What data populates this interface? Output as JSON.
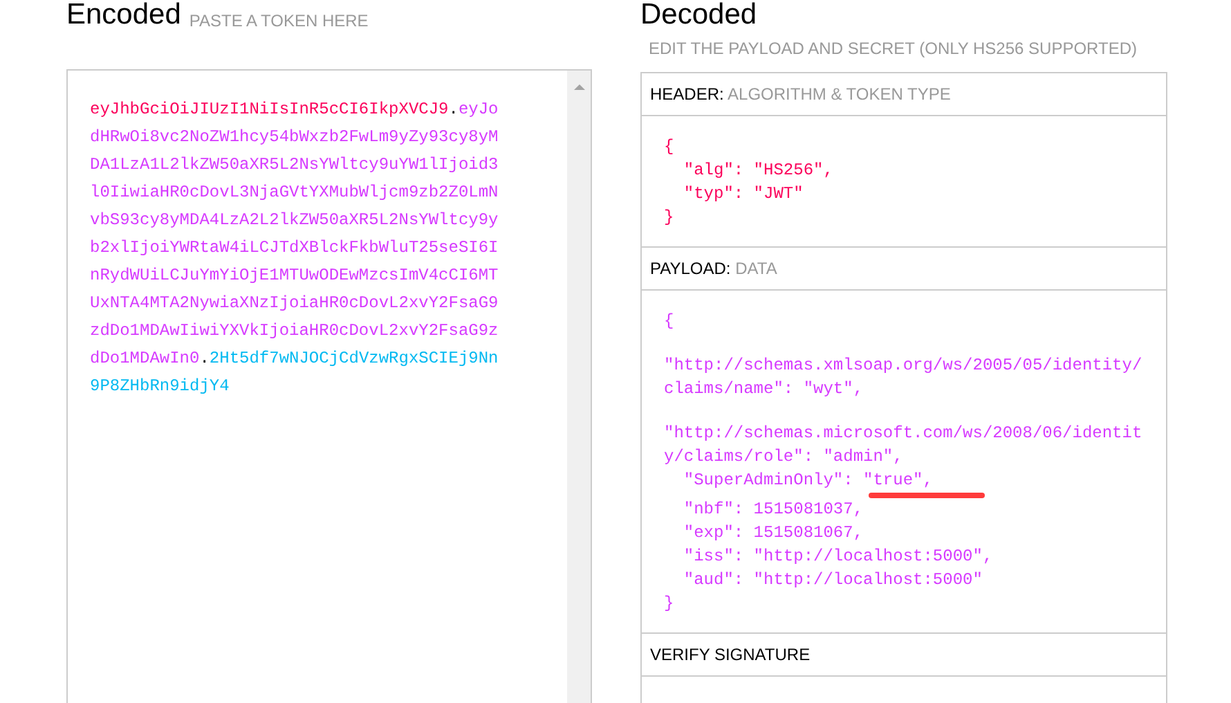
{
  "encoded": {
    "title": "Encoded",
    "subtitle": "PASTE A TOKEN HERE",
    "token": {
      "header": "eyJhbGciOiJIUzI1NiIsInR5cCI6IkpXVCJ9",
      "separator_1": ".",
      "payload": "eyJodHRwOi8vc2NoZW1hcy54bWxzb2FwLm9yZy93cy8yMDA1LzA1L2lkZW50aXR5L2NsYWltcy9uYW1lIjoid3l0IiwiaHR0cDovL3NjaGVtYXMubWljcm9zb2Z0LmNvbS93cy8yMDA4LzA2L2lkZW50aXR5L2NsYWltcy9yb2xlIjoiYWRtaW4iLCJTdXBlckFkbWluT25seSI6InRydWUiLCJuYmYiOjE1MTUwODEwMzcsImV4cCI6MTUxNTA4MTA2NywiaXNzIjoiaHR0cDovL2xvY2FsaG9zdDo1MDAwIiwiYXVkIjoiaHR0cDovL2xvY2FsaG9zdDo1MDAwIn0",
      "separator_2": ".",
      "signature": "2Ht5df7wNJOCjCdVzwRgxSCIEj9Nn9P8ZHbRn9idjY4"
    }
  },
  "decoded": {
    "title": "Decoded",
    "subtitle": "EDIT THE PAYLOAD AND SECRET (ONLY HS256 SUPPORTED)",
    "sections": [
      {
        "kind": "header",
        "label": "HEADER:",
        "sublabel": "ALGORITHM & TOKEN TYPE",
        "lines": [
          {
            "text": "{",
            "gap_before": false
          },
          {
            "text": "  \"alg\": \"HS256\",",
            "gap_before": false
          },
          {
            "text": "  \"typ\": \"JWT\"",
            "gap_before": false
          },
          {
            "text": "}",
            "gap_before": false
          }
        ]
      },
      {
        "kind": "payload",
        "label": "PAYLOAD:",
        "sublabel": "DATA",
        "lines": [
          {
            "text": "{",
            "gap_before": false
          },
          {
            "text": "\"http://schemas.xmlsoap.org/ws/2005/05/identity/",
            "gap_before": true
          },
          {
            "text": "claims/name\": \"wyt\",",
            "gap_before": false
          },
          {
            "text": "\"http://schemas.microsoft.com/ws/2008/06/identit",
            "gap_before": true
          },
          {
            "text": "y/claims/role\": \"admin\",",
            "gap_before": false
          },
          {
            "text": "  \"SuperAdminOnly\": \"true\",",
            "gap_before": false,
            "underlined": true
          },
          {
            "text": "  \"nbf\": 1515081037,",
            "gap_before": false
          },
          {
            "text": "  \"exp\": 1515081067,",
            "gap_before": false
          },
          {
            "text": "  \"iss\": \"http://localhost:5000\",",
            "gap_before": false
          },
          {
            "text": "  \"aud\": \"http://localhost:5000\"",
            "gap_before": false
          },
          {
            "text": "}",
            "gap_before": false
          }
        ]
      },
      {
        "kind": "verify",
        "label": "VERIFY SIGNATURE"
      }
    ]
  }
}
